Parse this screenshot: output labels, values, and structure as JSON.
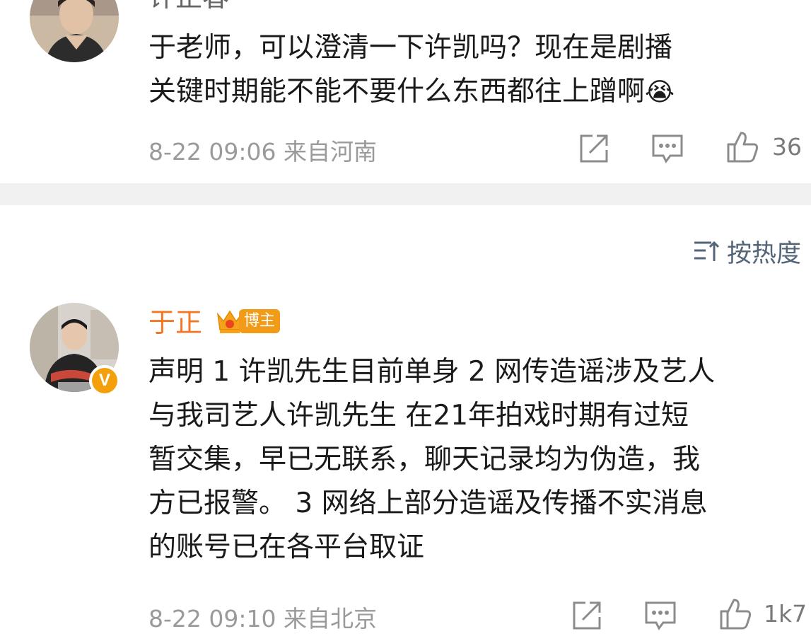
{
  "comment1": {
    "username": "许正春",
    "lines": [
      "于老师，可以澄清一下许凯吗？现在是剧播",
      "关键时期能不能不要什么东西都往上蹭啊"
    ],
    "emoji": "😭",
    "meta": "8-22 09:06 来自河南",
    "likes": "36"
  },
  "sort": {
    "label": "按热度"
  },
  "comment2": {
    "username": "于正",
    "badge_label": "博主",
    "verified_mark": "V",
    "lines": [
      "声明 1 许凯先生目前单身 2 网传造谣涉及艺人",
      "与我司艺人许凯先生 在21年拍戏时期有过短",
      "暂交集，早已无联系，聊天记录均为伪造，我",
      "方已报警。 3 网络上部分造谣及传播不实消息",
      "的账号已在各平台取证"
    ],
    "meta": "8-22 09:10 来自北京",
    "likes": "1k7"
  },
  "colors": {
    "username_normal": "#666666",
    "username_vip": "#f27624",
    "icon": "#8c8c8c",
    "sort_text": "#536579",
    "badge": "#f29b16",
    "verified": "#f4a00d"
  },
  "icons": {
    "share": "share-icon",
    "comment": "comment-icon",
    "like": "thumbs-up-icon",
    "sort": "sort-icon",
    "crown": "crown-icon"
  }
}
